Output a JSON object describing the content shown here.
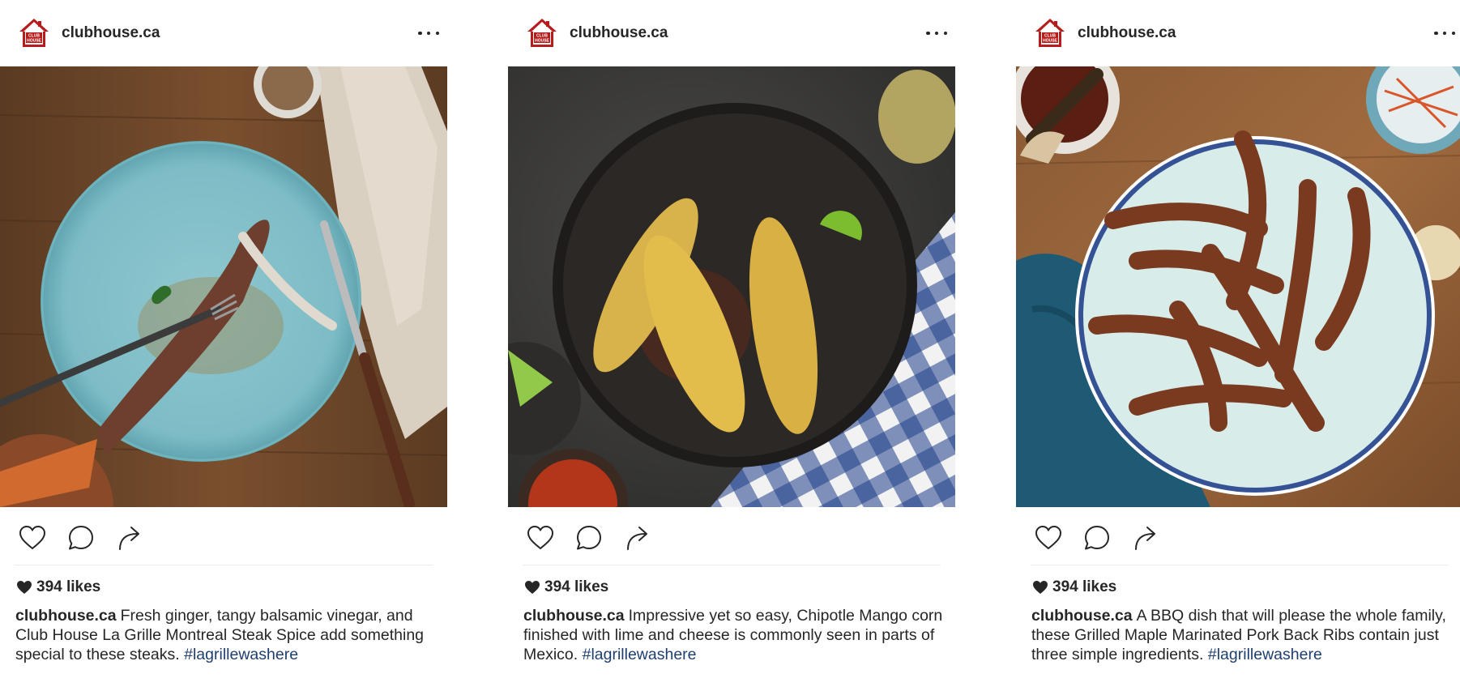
{
  "posts": [
    {
      "username": "clubhouse.ca",
      "likes": "394 likes",
      "caption_text": "Fresh ginger, tangy balsamic vinegar, and Club House La Grille Montreal Steak Spice add something special to these steaks.",
      "hashtag": "#lagrillewashere",
      "photo_subject": "steak-plate"
    },
    {
      "username": "clubhouse.ca",
      "likes": "394 likes",
      "caption_text": "Impressive yet so easy, Chipotle Mango corn finished with lime and cheese is commonly seen in parts of Mexico.",
      "hashtag": "#lagrillewashere",
      "photo_subject": "corn-plate"
    },
    {
      "username": "clubhouse.ca",
      "likes": "394 likes",
      "caption_text": "A BBQ dish that will please the whole family, these Grilled Maple Marinated Pork Back Ribs contain just three simple ingredients.",
      "hashtag": "#lagrillewashere",
      "photo_subject": "ribs-plate"
    }
  ],
  "logo_text": [
    "CLUB",
    "HOUSE"
  ],
  "colors": {
    "text": "#262626",
    "hashtag": "#1e3f6e",
    "logo_red": "#b71c1c",
    "divider": "#ececec"
  },
  "icons": [
    "heart-outline-icon",
    "comment-icon",
    "share-icon",
    "more-options-icon",
    "heart-filled-icon"
  ]
}
